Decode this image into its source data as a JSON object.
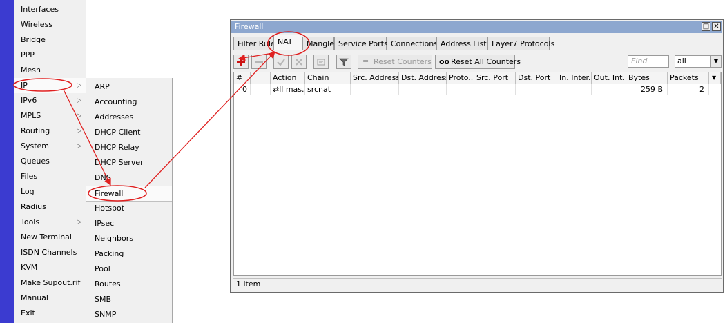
{
  "main_menu": [
    {
      "label": "Interfaces",
      "submenu": false
    },
    {
      "label": "Wireless",
      "submenu": false
    },
    {
      "label": "Bridge",
      "submenu": false
    },
    {
      "label": "PPP",
      "submenu": false
    },
    {
      "label": "Mesh",
      "submenu": false
    },
    {
      "label": "IP",
      "submenu": true
    },
    {
      "label": "IPv6",
      "submenu": true
    },
    {
      "label": "MPLS",
      "submenu": true
    },
    {
      "label": "Routing",
      "submenu": true
    },
    {
      "label": "System",
      "submenu": true
    },
    {
      "label": "Queues",
      "submenu": false
    },
    {
      "label": "Files",
      "submenu": false
    },
    {
      "label": "Log",
      "submenu": false
    },
    {
      "label": "Radius",
      "submenu": false
    },
    {
      "label": "Tools",
      "submenu": true
    },
    {
      "label": "New Terminal",
      "submenu": false
    },
    {
      "label": "ISDN Channels",
      "submenu": false
    },
    {
      "label": "KVM",
      "submenu": false
    },
    {
      "label": "Make Supout.rif",
      "submenu": false
    },
    {
      "label": "Manual",
      "submenu": false
    },
    {
      "label": "Exit",
      "submenu": false
    }
  ],
  "ip_submenu": [
    "ARP",
    "Accounting",
    "Addresses",
    "DHCP Client",
    "DHCP Relay",
    "DHCP Server",
    "DNS",
    "Firewall",
    "Hotspot",
    "IPsec",
    "Neighbors",
    "Packing",
    "Pool",
    "Routes",
    "SMB",
    "SNMP"
  ],
  "window": {
    "title": "Firewall",
    "tabs": [
      "Filter Rules",
      "NAT",
      "Mangle",
      "Service Ports",
      "Connections",
      "Address Lists",
      "Layer7 Protocols"
    ],
    "active_tab": "NAT",
    "toolbar": {
      "reset_counters": "Reset Counters",
      "reset_all_counters": "Reset All Counters",
      "reset_all_icon_text": "oo",
      "find_placeholder": "Find",
      "filter_value": "all"
    },
    "columns": [
      "#",
      "",
      "Action",
      "Chain",
      "Src. Address",
      "Dst. Address",
      "Proto...",
      "Src. Port",
      "Dst. Port",
      "In. Inter...",
      "Out. Int...",
      "Bytes",
      "Packets"
    ],
    "rows": [
      {
        "num": "0",
        "flag": "",
        "action": "⇄ll mas...",
        "chain": "srcnat",
        "src_address": "",
        "dst_address": "",
        "proto": "",
        "src_port": "",
        "dst_port": "",
        "in_interface": "",
        "out_interface": "",
        "bytes": "259 B",
        "packets": "2"
      }
    ],
    "status": "1 item"
  },
  "colors": {
    "annotation": "#e02020",
    "sidestrip": "#3b3bd0",
    "titlebar": "#8da7cf",
    "add_icon": "#cc1111"
  }
}
